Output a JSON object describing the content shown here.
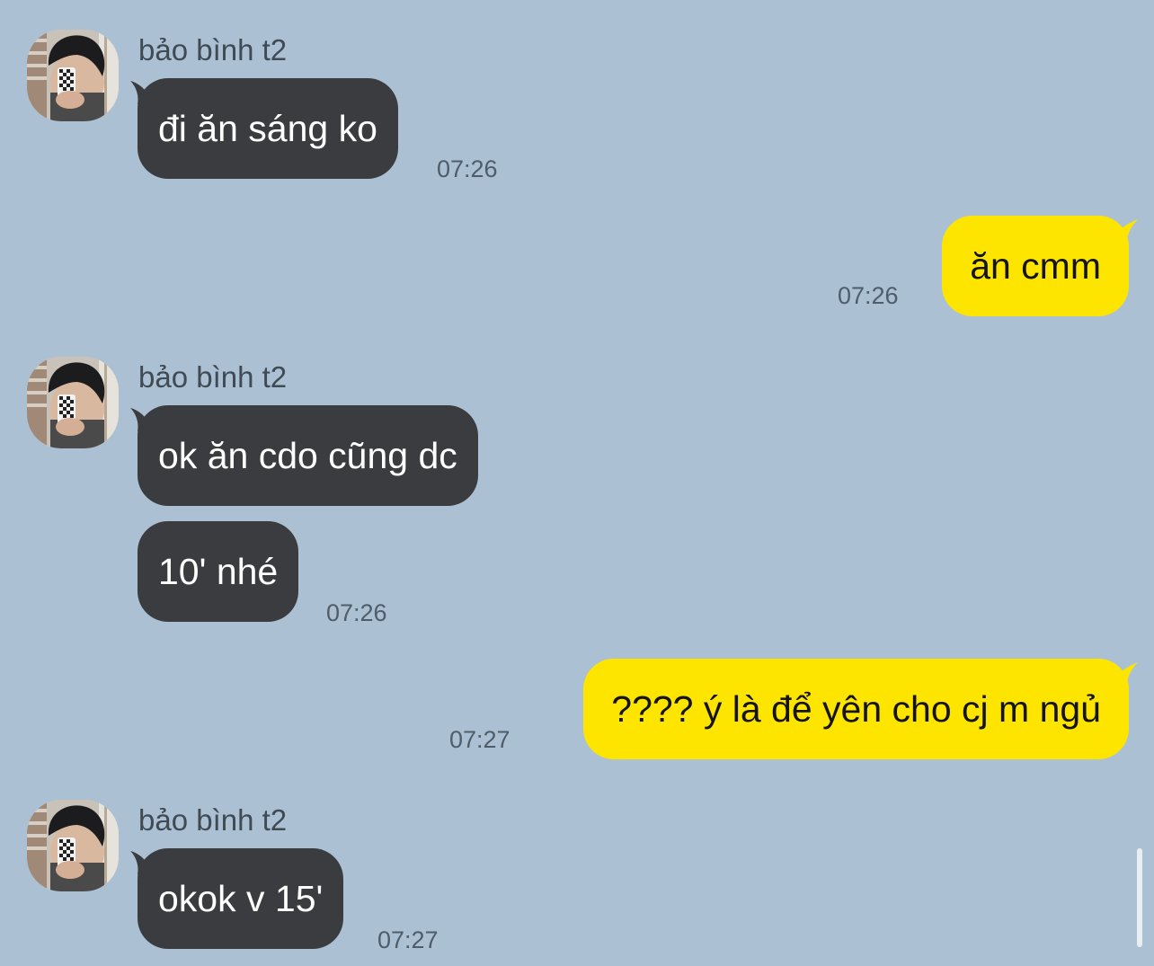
{
  "contact": {
    "name": "bảo bình t2",
    "avatar_icon": "profile-photo"
  },
  "colors": {
    "background": "#abc1d3",
    "incoming_bubble": "#3b3c3f",
    "outgoing_bubble": "#fee500"
  },
  "messages": {
    "m1": {
      "text": "đi ăn sáng ko",
      "time": "07:26"
    },
    "m2": {
      "text": "ăn cmm",
      "time": "07:26"
    },
    "m3": {
      "text": "ok ăn cdo cũng dc"
    },
    "m4": {
      "text": "10' nhé",
      "time": "07:26"
    },
    "m5": {
      "text": "???? ý là để yên cho cj m ngủ",
      "time": "07:27"
    },
    "m6": {
      "text": "okok v 15'",
      "time": "07:27"
    }
  }
}
